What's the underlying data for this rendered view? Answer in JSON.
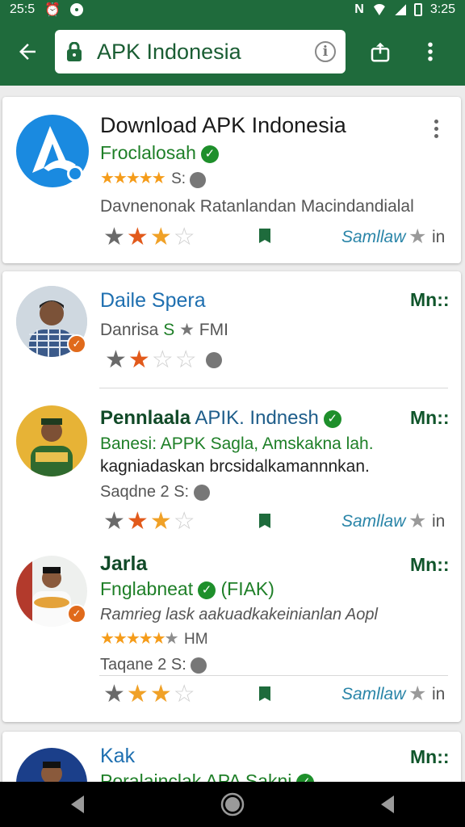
{
  "status": {
    "time_left": "25:5",
    "time_right": "3:25"
  },
  "toolbar": {
    "url": "APK Indonesia"
  },
  "featured": {
    "title": "Download APK Indonesia",
    "publisher": "Froclalosah",
    "rating_extra": "S:",
    "description": "Davnenonak Ratanlandan Macindandialal",
    "link": "Samllaw",
    "link_suffix": "in"
  },
  "list": [
    {
      "title": "Daile Spera",
      "side": "Mn::",
      "meta_prefix": "Danrisa",
      "meta_s": "S",
      "meta_suffix": "FMI"
    },
    {
      "title_bold": "Pennlaala",
      "title_rest": "APIK. Indnesh",
      "side": "Mn::",
      "line1": "Banesi:  APPK Sagla, Amskakna lah.",
      "line2": "kagniadaskan brcsidalkamannnkan.",
      "meta": "Saqdne 2",
      "meta_s": "S:",
      "link": "Samllaw",
      "link_suffix": "in"
    },
    {
      "title": "Jarla",
      "side": "Mn::",
      "publisher": "Fnglabneat",
      "publisher_tag": "(FIAK)",
      "desc": "Ramrieg lask aakuadkakeinianlan Aopl",
      "rating_suffix": "HM",
      "meta": "Taqane 2",
      "meta_s": "S:",
      "link": "Samllaw",
      "link_suffix": "in"
    },
    {
      "title": "Kak",
      "side": "Mn::",
      "publisher": "Poralainclak APA Sakni"
    }
  ],
  "colors": {
    "brand_green": "#1f6b3c",
    "accent_orange": "#e25a1b",
    "star_amber": "#f0a127"
  }
}
